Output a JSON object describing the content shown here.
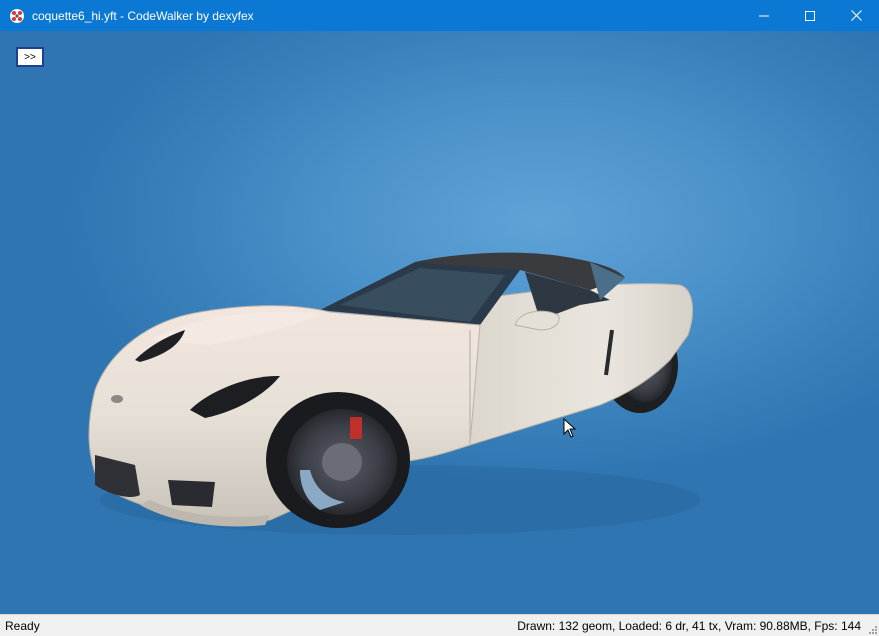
{
  "window": {
    "title": "coquette6_hi.yft - CodeWalker by dexyfex",
    "app_icon": "codewalker-icon",
    "controls": {
      "minimize_icon": "minimize-icon",
      "maximize_icon": "maximize-icon",
      "close_icon": "close-icon"
    }
  },
  "viewport": {
    "toggle_button_label": ">>",
    "model": "sports-car-3d-model",
    "cursor": "arrow-cursor-icon"
  },
  "statusbar": {
    "status": "Ready",
    "stats": "Drawn: 132 geom, Loaded: 6 dr, 41 tx, Vram: 90.88MB, Fps: 144"
  },
  "colors": {
    "titlebar": "#0b79d4",
    "viewport_bg": "#3f86bf",
    "statusbar": "#f0f0f0",
    "car_body": "#e8e2d8"
  }
}
